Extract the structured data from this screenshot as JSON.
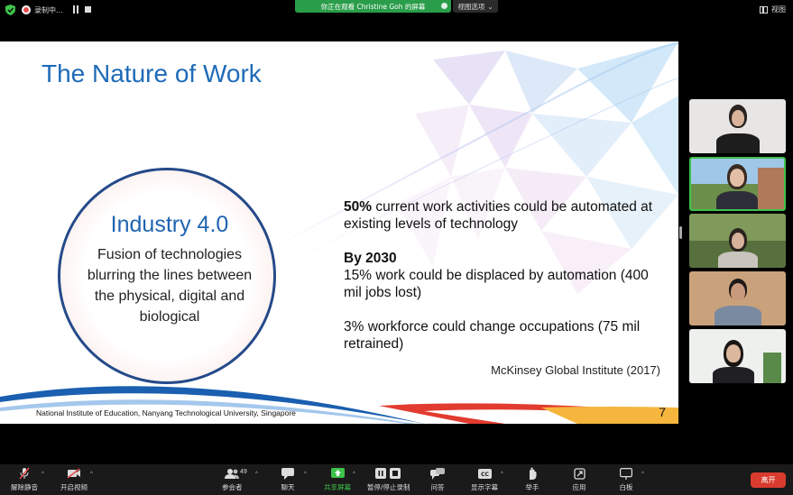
{
  "topbar": {
    "recording_label": "录制中...",
    "viewing_banner": "你正在观看 Christine Goh 的屏幕",
    "view_options_label": "视图选项",
    "view_label": "视图"
  },
  "slide": {
    "title": "The Nature of Work",
    "circle_title": "Industry 4.0",
    "circle_body": "Fusion of technologies blurring the lines between the physical, digital and biological",
    "stat1_bold": "50%",
    "stat1_text": " current work activities could be automated at existing levels of technology",
    "stat2_heading": "By 2030",
    "stat2_text": "15% work could be displaced by automation (400 mil jobs lost)",
    "stat3_text": "3% workforce could change occupations (75 mil retrained)",
    "source": "McKinsey Global Institute (2017)",
    "footer": "National Institute of Education, Nanyang Technological University, Singapore",
    "page_number": "7"
  },
  "toolbar": {
    "unmute_label": "解除静音",
    "start_video_label": "开启视频",
    "participants_label": "参会者",
    "participants_count": "49",
    "chat_label": "聊天",
    "share_label": "共享屏幕",
    "pause_record_label": "暂停/停止录制",
    "qa_label": "问答",
    "captions_label": "显示字幕",
    "raise_hand_label": "举手",
    "apps_label": "应用",
    "whiteboard_label": "白板",
    "leave_label": "离开"
  },
  "colors": {
    "banner_green": "#2a9d4a",
    "title_blue": "#1e6bb8",
    "leave_red": "#d93b2e",
    "active_border": "#3ec24a"
  }
}
